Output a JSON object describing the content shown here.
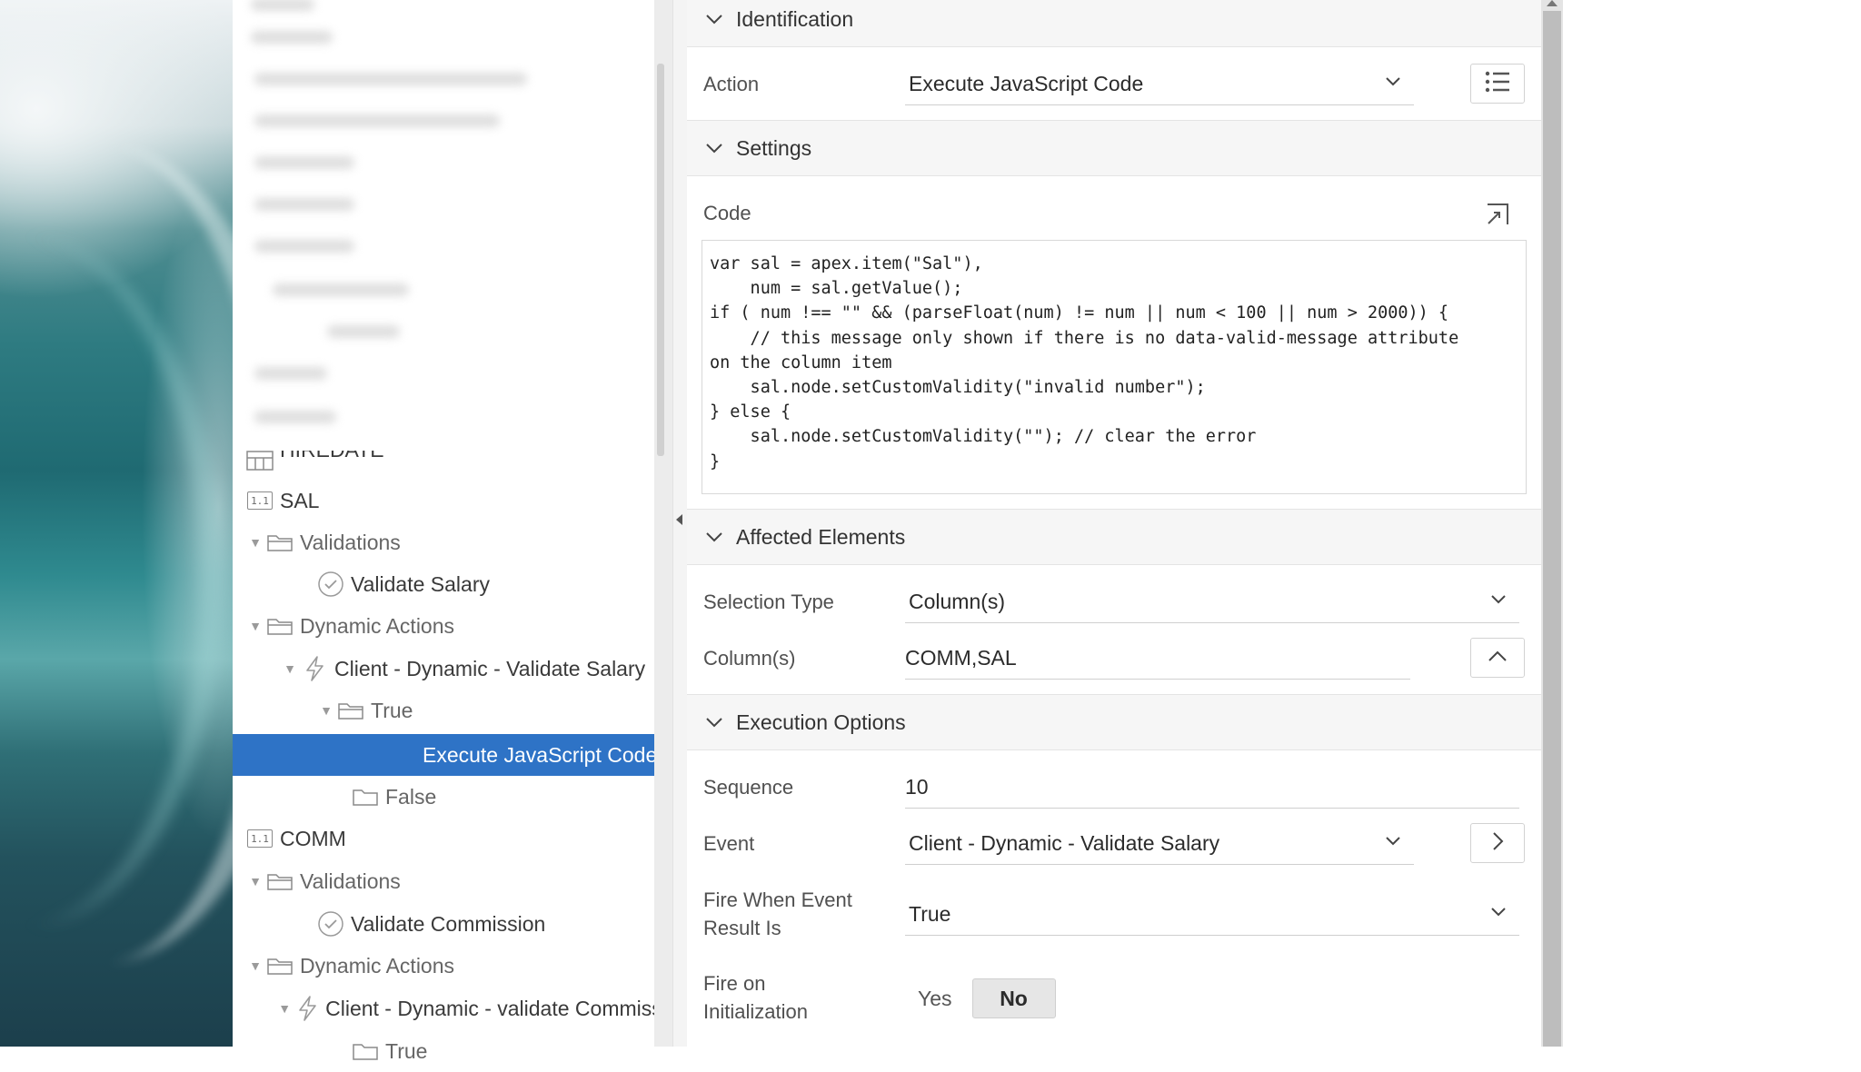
{
  "tree": {
    "items": [
      {
        "label": "HIREDATE",
        "icon": "table-column-icon"
      },
      {
        "label": "SAL",
        "icon": "number-column-icon",
        "icon_text": "1.1"
      },
      {
        "label": "Validations",
        "icon": "folder-icon"
      },
      {
        "label": "Validate Salary",
        "icon": "check-circle-icon"
      },
      {
        "label": "Dynamic Actions",
        "icon": "folder-icon"
      },
      {
        "label": "Client - Dynamic - Validate Salary",
        "icon": "lightning-icon"
      },
      {
        "label": "True",
        "icon": "folder-icon"
      },
      {
        "label": "Execute JavaScript Code",
        "icon": "none",
        "selected": true
      },
      {
        "label": "False",
        "icon": "folder-icon"
      },
      {
        "label": "COMM",
        "icon": "number-column-icon",
        "icon_text": "1.1"
      },
      {
        "label": "Validations",
        "icon": "folder-icon"
      },
      {
        "label": "Validate Commission",
        "icon": "check-circle-icon"
      },
      {
        "label": "Dynamic Actions",
        "icon": "folder-icon"
      },
      {
        "label": "Client - Dynamic - validate Commission",
        "icon": "lightning-icon"
      },
      {
        "label": "True",
        "icon": "folder-icon"
      }
    ]
  },
  "sections": {
    "identification": "Identification",
    "settings": "Settings",
    "affected": "Affected Elements",
    "execution": "Execution Options"
  },
  "identification": {
    "action_label": "Action",
    "action_value": "Execute JavaScript Code"
  },
  "settings": {
    "code_label": "Code",
    "code": "var sal = apex.item(\"Sal\"),\n    num = sal.getValue();\nif ( num !== \"\" && (parseFloat(num) != num || num < 100 || num > 2000)) {\n    // this message only shown if there is no data-valid-message attribute\non the column item\n    sal.node.setCustomValidity(\"invalid number\");\n} else {\n    sal.node.setCustomValidity(\"\"); // clear the error\n}"
  },
  "affected": {
    "selection_type_label": "Selection Type",
    "selection_type_value": "Column(s)",
    "columns_label": "Column(s)",
    "columns_value": "COMM,SAL"
  },
  "execution": {
    "sequence_label": "Sequence",
    "sequence_value": "10",
    "event_label": "Event",
    "event_value": "Client - Dynamic - Validate Salary",
    "fire_when_label_1": "Fire When Event",
    "fire_when_label_2": "Result Is",
    "fire_when_value": "True",
    "fire_init_label_1": "Fire on",
    "fire_init_label_2": "Initialization",
    "yes": "Yes",
    "no": "No"
  },
  "colors": {
    "selected_row": "#2e73c6",
    "section_header": "#f6f6f6"
  }
}
